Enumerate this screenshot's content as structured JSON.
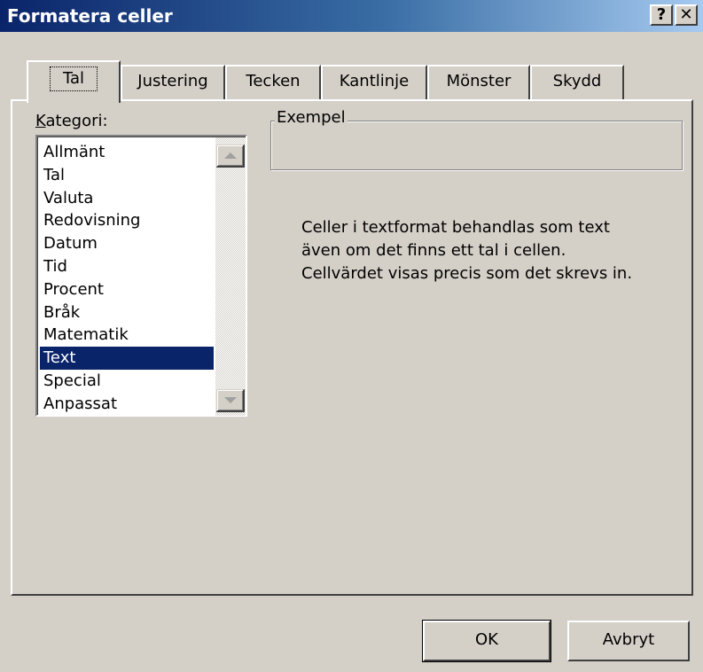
{
  "window": {
    "title": "Formatera celler",
    "help_label": "?",
    "close_label": "✕"
  },
  "tabs": [
    {
      "label": "Tal",
      "active": true
    },
    {
      "label": "Justering"
    },
    {
      "label": "Tecken"
    },
    {
      "label": "Kantlinje"
    },
    {
      "label": "Mönster"
    },
    {
      "label": "Skydd"
    }
  ],
  "category": {
    "label_first": "K",
    "label_rest": "ategori:",
    "items": [
      "Allmänt",
      "Tal",
      "Valuta",
      "Redovisning",
      "Datum",
      "Tid",
      "Procent",
      "Bråk",
      "Matematik",
      "Text",
      "Special",
      "Anpassat"
    ],
    "selected": "Text"
  },
  "example": {
    "label": "Exempel",
    "value": ""
  },
  "description": [
    "Celler i textformat behandlas som text",
    "även om det finns ett tal i cellen.",
    "Cellvärdet visas precis som det skrevs in."
  ],
  "buttons": {
    "ok": "OK",
    "cancel": "Avbryt"
  },
  "colors": {
    "selection": "#0a246a",
    "face": "#d4d0c8",
    "title_start": "#0a246a",
    "title_end": "#a6caf0"
  }
}
